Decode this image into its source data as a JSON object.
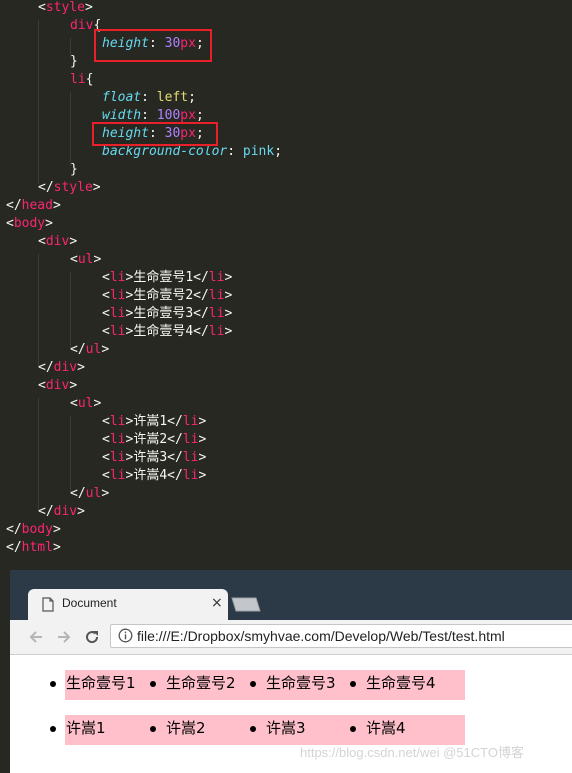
{
  "editor": {
    "lines": [
      [
        [
          "punct",
          "<"
        ],
        [
          "tag",
          "style"
        ],
        [
          "punct",
          ">"
        ]
      ],
      [
        [
          "tag",
          "div"
        ],
        [
          "punct",
          "{"
        ]
      ],
      [
        [
          "prop",
          "height"
        ],
        [
          "punct",
          ": "
        ],
        [
          "num",
          "30"
        ],
        [
          "unit",
          "px"
        ],
        [
          "punct",
          ";"
        ]
      ],
      [
        [
          "punct",
          "}"
        ]
      ],
      [
        [
          "tag",
          "li"
        ],
        [
          "punct",
          "{"
        ]
      ],
      [
        [
          "prop",
          "float"
        ],
        [
          "punct",
          ": "
        ],
        [
          "kw",
          "left"
        ],
        [
          "punct",
          ";"
        ]
      ],
      [
        [
          "prop",
          "width"
        ],
        [
          "punct",
          ": "
        ],
        [
          "num",
          "100"
        ],
        [
          "unit",
          "px"
        ],
        [
          "punct",
          ";"
        ]
      ],
      [
        [
          "prop",
          "height"
        ],
        [
          "punct",
          ": "
        ],
        [
          "num",
          "30"
        ],
        [
          "unit",
          "px"
        ],
        [
          "punct",
          ";"
        ]
      ],
      [
        [
          "prop",
          "background-color"
        ],
        [
          "punct",
          ": "
        ],
        [
          "plain",
          "pink"
        ],
        [
          "punct",
          ";"
        ]
      ],
      [
        [
          "punct",
          "}"
        ]
      ],
      [
        [
          "punct",
          "</"
        ],
        [
          "tag",
          "style"
        ],
        [
          "punct",
          ">"
        ]
      ],
      [
        [
          "punct",
          "</"
        ],
        [
          "tag",
          "head"
        ],
        [
          "punct",
          ">"
        ]
      ],
      [
        [
          "punct",
          "<"
        ],
        [
          "tag",
          "body"
        ],
        [
          "punct",
          ">"
        ]
      ],
      [
        [
          "punct",
          "<"
        ],
        [
          "tag",
          "div"
        ],
        [
          "punct",
          ">"
        ]
      ],
      [
        [
          "punct",
          "<"
        ],
        [
          "tag",
          "ul"
        ],
        [
          "punct",
          ">"
        ]
      ],
      [
        [
          "punct",
          "<"
        ],
        [
          "tag",
          "li"
        ],
        [
          "punct",
          ">"
        ],
        [
          "text",
          "生命壹号1"
        ],
        [
          "punct",
          "</"
        ],
        [
          "tag",
          "li"
        ],
        [
          "punct",
          ">"
        ]
      ],
      [
        [
          "punct",
          "<"
        ],
        [
          "tag",
          "li"
        ],
        [
          "punct",
          ">"
        ],
        [
          "text",
          "生命壹号2"
        ],
        [
          "punct",
          "</"
        ],
        [
          "tag",
          "li"
        ],
        [
          "punct",
          ">"
        ]
      ],
      [
        [
          "punct",
          "<"
        ],
        [
          "tag",
          "li"
        ],
        [
          "punct",
          ">"
        ],
        [
          "text",
          "生命壹号3"
        ],
        [
          "punct",
          "</"
        ],
        [
          "tag",
          "li"
        ],
        [
          "punct",
          ">"
        ]
      ],
      [
        [
          "punct",
          "<"
        ],
        [
          "tag",
          "li"
        ],
        [
          "punct",
          ">"
        ],
        [
          "text",
          "生命壹号4"
        ],
        [
          "punct",
          "</"
        ],
        [
          "tag",
          "li"
        ],
        [
          "punct",
          ">"
        ]
      ],
      [
        [
          "punct",
          "</"
        ],
        [
          "tag",
          "ul"
        ],
        [
          "punct",
          ">"
        ]
      ],
      [
        [
          "punct",
          "</"
        ],
        [
          "tag",
          "div"
        ],
        [
          "punct",
          ">"
        ]
      ],
      [
        [
          "punct",
          "<"
        ],
        [
          "tag",
          "div"
        ],
        [
          "punct",
          ">"
        ]
      ],
      [
        [
          "punct",
          "<"
        ],
        [
          "tag",
          "ul"
        ],
        [
          "punct",
          ">"
        ]
      ],
      [
        [
          "punct",
          "<"
        ],
        [
          "tag",
          "li"
        ],
        [
          "punct",
          ">"
        ],
        [
          "text",
          "许嵩1"
        ],
        [
          "punct",
          "</"
        ],
        [
          "tag",
          "li"
        ],
        [
          "punct",
          ">"
        ]
      ],
      [
        [
          "punct",
          "<"
        ],
        [
          "tag",
          "li"
        ],
        [
          "punct",
          ">"
        ],
        [
          "text",
          "许嵩2"
        ],
        [
          "punct",
          "</"
        ],
        [
          "tag",
          "li"
        ],
        [
          "punct",
          ">"
        ]
      ],
      [
        [
          "punct",
          "<"
        ],
        [
          "tag",
          "li"
        ],
        [
          "punct",
          ">"
        ],
        [
          "text",
          "许嵩3"
        ],
        [
          "punct",
          "</"
        ],
        [
          "tag",
          "li"
        ],
        [
          "punct",
          ">"
        ]
      ],
      [
        [
          "punct",
          "<"
        ],
        [
          "tag",
          "li"
        ],
        [
          "punct",
          ">"
        ],
        [
          "text",
          "许嵩4"
        ],
        [
          "punct",
          "</"
        ],
        [
          "tag",
          "li"
        ],
        [
          "punct",
          ">"
        ]
      ],
      [
        [
          "punct",
          "</"
        ],
        [
          "tag",
          "ul"
        ],
        [
          "punct",
          ">"
        ]
      ],
      [
        [
          "punct",
          "</"
        ],
        [
          "tag",
          "div"
        ],
        [
          "punct",
          ">"
        ]
      ],
      [
        [
          "punct",
          "</"
        ],
        [
          "tag",
          "body"
        ],
        [
          "punct",
          ">"
        ]
      ],
      [
        [
          "punct",
          "</"
        ],
        [
          "tag",
          "html"
        ],
        [
          "punct",
          ">"
        ]
      ]
    ],
    "colors": {
      "background": "#272822",
      "tag": "#f92672",
      "property": "#66d9ef",
      "number": "#ae81ff",
      "keyword": "#e6db74",
      "text": "#f8f8f2",
      "highlight_box": "#e8202a"
    }
  },
  "browser": {
    "tab_title": "Document",
    "tab_close": "×",
    "url": "file:///E:/Dropbox/smyhvae.com/Develop/Web/Test/test.html",
    "nav_icons": [
      "back-arrow-icon",
      "forward-arrow-icon",
      "reload-icon",
      "info-icon"
    ],
    "page": {
      "list1": [
        "生命壹号1",
        "生命壹号2",
        "生命壹号3",
        "生命壹号4"
      ],
      "list2": [
        "许嵩1",
        "许嵩2",
        "许嵩3",
        "许嵩4"
      ],
      "li_background": "pink"
    },
    "watermark": "https://blog.csdn.net/wei @51CTO博客"
  }
}
